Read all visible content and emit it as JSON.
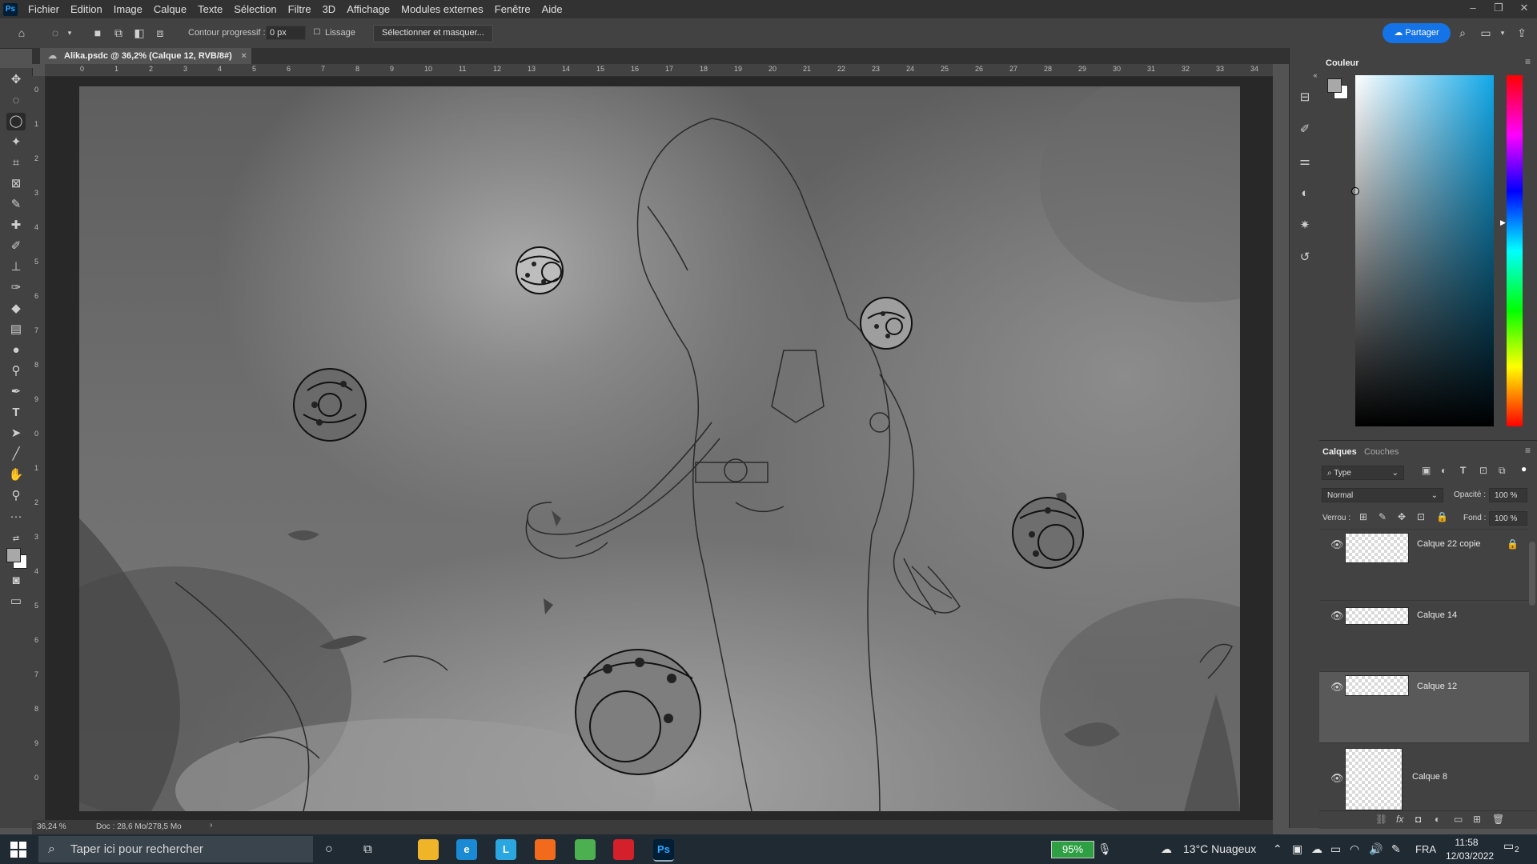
{
  "app": {
    "logo": "Ps",
    "menu": [
      "Fichier",
      "Edition",
      "Image",
      "Calque",
      "Texte",
      "Sélection",
      "Filtre",
      "3D",
      "Affichage",
      "Modules externes",
      "Fenêtre",
      "Aide"
    ]
  },
  "options": {
    "feather_label": "Contour progressif :",
    "feather_value": "0 px",
    "antialias_label": "Lissage",
    "select_mask_label": "Sélectionner et masquer...",
    "share_label": "Partager"
  },
  "document": {
    "tab_title": "Alika.psdc @ 36,2% (Calque 12, RVB/8#)",
    "zoom": "36,24 %",
    "doc_info": "Doc : 28,6 Mo/278,5 Mo"
  },
  "rulers": {
    "top": [
      "0",
      "1",
      "2",
      "3",
      "4",
      "5",
      "6",
      "7",
      "8",
      "9",
      "10",
      "11",
      "12",
      "13",
      "14",
      "15",
      "16",
      "17",
      "18",
      "19",
      "20",
      "21",
      "22",
      "23",
      "24",
      "25",
      "26",
      "27",
      "28",
      "29",
      "30",
      "31",
      "32",
      "33",
      "34"
    ],
    "left": [
      "0",
      "1",
      "2",
      "3",
      "4",
      "5",
      "6",
      "7",
      "8",
      "9",
      "0",
      "1",
      "2",
      "3",
      "4",
      "5",
      "6",
      "7",
      "8",
      "9",
      "0"
    ]
  },
  "color_panel": {
    "title": "Couleur",
    "foreground": "#a8a8a8",
    "background": "#ffffff"
  },
  "layers_panel": {
    "tab_layers": "Calques",
    "tab_channels": "Couches",
    "filter": "Type",
    "blend_mode": "Normal",
    "opacity_label": "Opacité :",
    "opacity_value": "100 %",
    "lock_label": "Verrou :",
    "fill_label": "Fond :",
    "fill_value": "100 %",
    "layers": [
      {
        "name": "Calque 22 copie",
        "selected": false,
        "locked": true
      },
      {
        "name": "Calque 14",
        "selected": false,
        "locked": false
      },
      {
        "name": "Calque 12",
        "selected": true,
        "locked": false
      },
      {
        "name": "Calque 8",
        "selected": false,
        "locked": false
      }
    ]
  },
  "taskbar": {
    "search_placeholder": "Taper ici pour rechercher",
    "battery": "95%",
    "weather": "13°C  Nuageux",
    "lang": "FRA",
    "time": "11:58",
    "date": "12/03/2022",
    "notifications": "2",
    "apps": [
      {
        "name": "file-explorer",
        "label": "",
        "color": "#f0b429"
      },
      {
        "name": "edge",
        "label": "e",
        "color": "#1a8ad4"
      },
      {
        "name": "app-l",
        "label": "L",
        "color": "#2aa7e0"
      },
      {
        "name": "app-orange",
        "label": "",
        "color": "#f26b1d"
      },
      {
        "name": "chrome",
        "label": "",
        "color": "#4caf50"
      },
      {
        "name": "acrobat",
        "label": "",
        "color": "#d4202a"
      },
      {
        "name": "photoshop",
        "label": "Ps",
        "color": "#001e36"
      }
    ]
  }
}
